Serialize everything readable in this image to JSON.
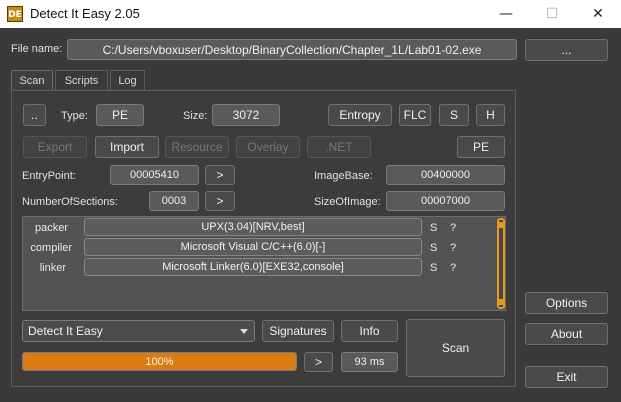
{
  "window": {
    "title": "Detect It Easy 2.05",
    "icon_text": "DE",
    "minimize": "—",
    "maximize": "☐",
    "close": "✕"
  },
  "file": {
    "label": "File name:",
    "path": "C:/Users/vboxuser/Desktop/BinaryCollection/Chapter_1L/Lab01-02.exe",
    "browse_label": "..."
  },
  "tabs": [
    {
      "label": "Scan",
      "active": true
    },
    {
      "label": "Scripts",
      "active": false
    },
    {
      "label": "Log",
      "active": false
    }
  ],
  "info": {
    "up_label": "..",
    "type_label": "Type:",
    "type_value": "PE",
    "size_label": "Size:",
    "size_value": "3072",
    "entropy_label": "Entropy",
    "flc_label": "FLC",
    "s_label": "S",
    "h_label": "H",
    "pe_label": "PE",
    "export_label": "Export",
    "import_label": "Import",
    "resource_label": "Resource",
    "overlay_label": "Overlay",
    "net_label": ".NET",
    "entrypoint_label": "EntryPoint:",
    "entrypoint_value": "00005410",
    "entrypoint_go": ">",
    "imagebase_label": "ImageBase:",
    "imagebase_value": "00400000",
    "sections_label": "NumberOfSections:",
    "sections_value": "0003",
    "sections_go": ">",
    "sizeofimage_label": "SizeOfImage:",
    "sizeofimage_value": "00007000"
  },
  "results": [
    {
      "type": "packer",
      "name": "UPX(3.04)[NRV,best]",
      "s": "S",
      "q": "?"
    },
    {
      "type": "compiler",
      "name": "Microsoft Visual C/C++(6.0)[-]",
      "s": "S",
      "q": "?"
    },
    {
      "type": "linker",
      "name": "Microsoft Linker(6.0)[EXE32,console]",
      "s": "S",
      "q": "?"
    }
  ],
  "bottom": {
    "database_selected": "Detect It Easy",
    "signatures_label": "Signatures",
    "info_label": "Info",
    "scan_label": "Scan",
    "progress_text": "100%",
    "progress_value": 1.0,
    "next_label": ">",
    "time_value": "93 ms"
  },
  "side": {
    "options_label": "Options",
    "about_label": "About",
    "exit_label": "Exit"
  },
  "colors": {
    "accent": "#da7b14",
    "background": "#3a3a3a"
  }
}
